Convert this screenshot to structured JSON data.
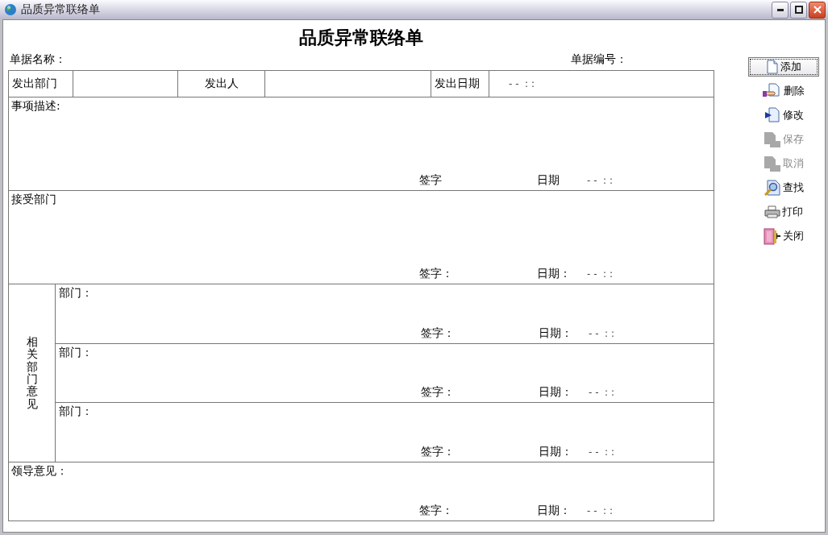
{
  "window": {
    "title": "品质异常联络单"
  },
  "form": {
    "title": "品质异常联络单",
    "bill_name_label": "单据名称：",
    "bill_no_label": "单据编号：",
    "header_cells": [
      {
        "kind": "label",
        "text": "发出部门"
      },
      {
        "kind": "input"
      },
      {
        "kind": "label",
        "text": "发出人"
      },
      {
        "kind": "input"
      },
      {
        "kind": "label",
        "text": "发出日期"
      },
      {
        "kind": "input",
        "value": "- -  : :"
      }
    ],
    "sections": [
      {
        "kind": "plain",
        "label": "事项描述:",
        "sign_label": "签字",
        "date_label": "日期",
        "date_value": "- -  : :"
      },
      {
        "kind": "plain",
        "label": "接受部门",
        "sign_label": "签字：",
        "date_label": "日期：",
        "date_value": "- -  : :"
      },
      {
        "kind": "group",
        "label": "相关部门意见",
        "entries": [
          {
            "label": "部门：",
            "sign_label": "签字：",
            "date_label": "日期：",
            "date_value": "- -  : :"
          },
          {
            "label": "部门：",
            "sign_label": "签字：",
            "date_label": "日期：",
            "date_value": "- -  : :"
          },
          {
            "label": "部门：",
            "sign_label": "签字：",
            "date_label": "日期：",
            "date_value": "- -  : :"
          }
        ]
      },
      {
        "kind": "plain",
        "label": "领导意见：",
        "sign_label": "签字：",
        "date_label": "日期：",
        "date_value": "- -  : :"
      }
    ]
  },
  "toolbar": [
    {
      "kind": "add",
      "label": "添加",
      "focused": true,
      "disabled": false
    },
    {
      "kind": "delete",
      "label": "删除",
      "focused": false,
      "disabled": false
    },
    {
      "kind": "edit",
      "label": "修改",
      "focused": false,
      "disabled": false
    },
    {
      "kind": "save",
      "label": "保存",
      "focused": false,
      "disabled": true
    },
    {
      "kind": "cancel",
      "label": "取消",
      "focused": false,
      "disabled": true
    },
    {
      "kind": "find",
      "label": "查找",
      "focused": false,
      "disabled": false
    },
    {
      "kind": "print",
      "label": "打印",
      "focused": false,
      "disabled": false
    },
    {
      "kind": "close",
      "label": "关闭",
      "focused": false,
      "disabled": false
    }
  ]
}
